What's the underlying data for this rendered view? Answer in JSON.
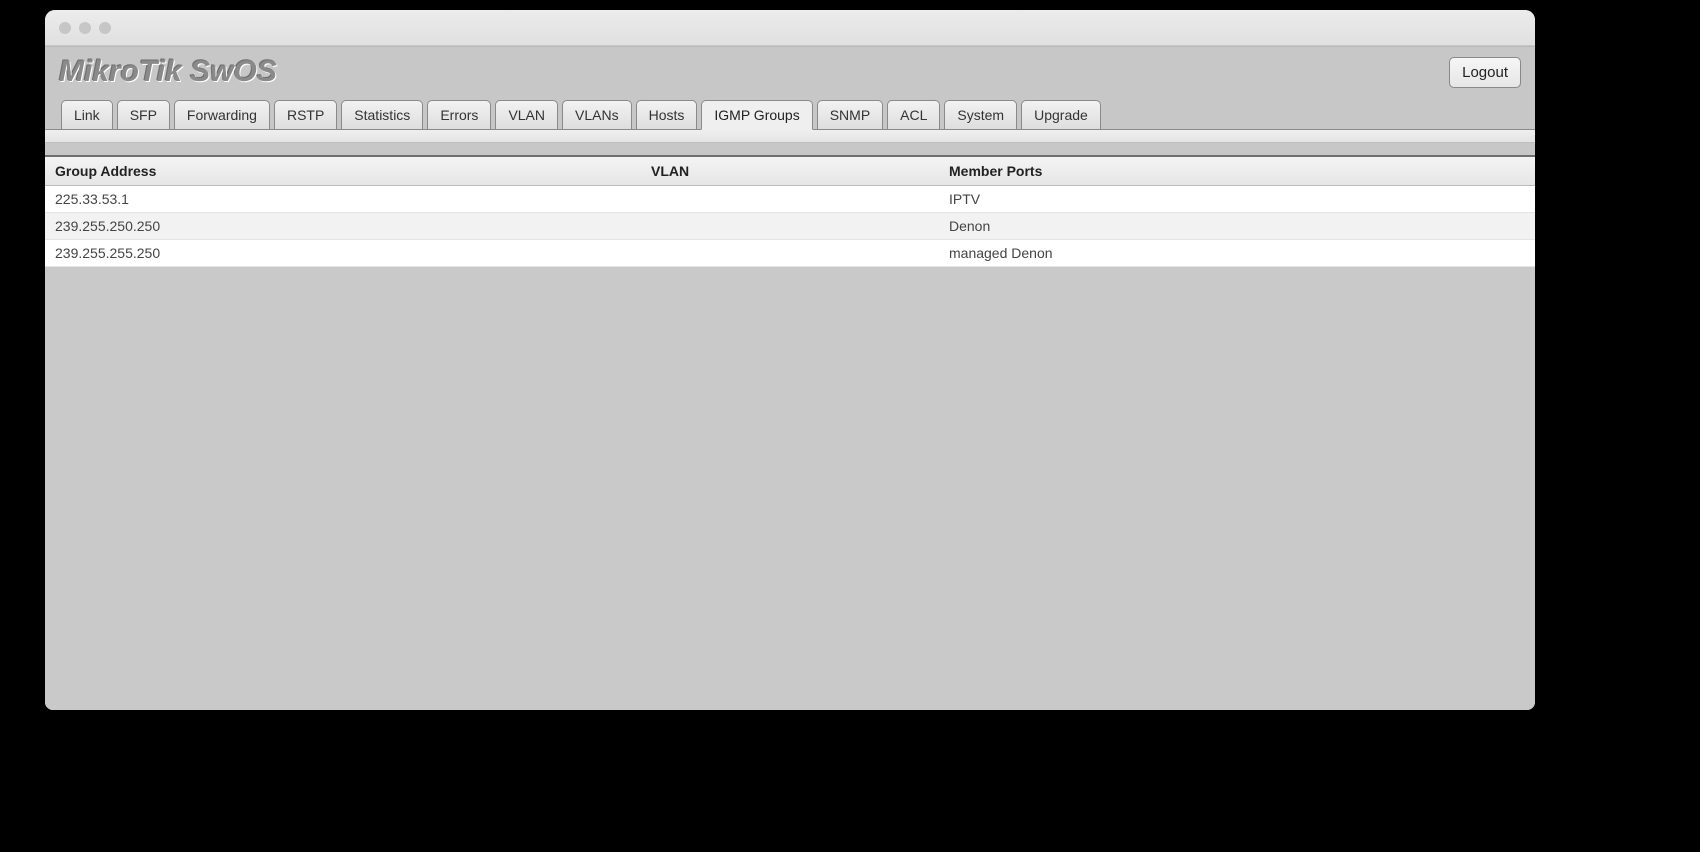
{
  "header": {
    "title": "MikroTik SwOS",
    "logout_label": "Logout"
  },
  "tabs": [
    {
      "id": "link",
      "label": "Link",
      "active": false
    },
    {
      "id": "sfp",
      "label": "SFP",
      "active": false
    },
    {
      "id": "forwarding",
      "label": "Forwarding",
      "active": false
    },
    {
      "id": "rstp",
      "label": "RSTP",
      "active": false
    },
    {
      "id": "statistics",
      "label": "Statistics",
      "active": false
    },
    {
      "id": "errors",
      "label": "Errors",
      "active": false
    },
    {
      "id": "vlan",
      "label": "VLAN",
      "active": false
    },
    {
      "id": "vlans",
      "label": "VLANs",
      "active": false
    },
    {
      "id": "hosts",
      "label": "Hosts",
      "active": false
    },
    {
      "id": "igmp-groups",
      "label": "IGMP Groups",
      "active": true
    },
    {
      "id": "snmp",
      "label": "SNMP",
      "active": false
    },
    {
      "id": "acl",
      "label": "ACL",
      "active": false
    },
    {
      "id": "system",
      "label": "System",
      "active": false
    },
    {
      "id": "upgrade",
      "label": "Upgrade",
      "active": false
    }
  ],
  "table": {
    "columns": {
      "group_address": "Group Address",
      "vlan": "VLAN",
      "member_ports": "Member Ports"
    },
    "rows": [
      {
        "group_address": "225.33.53.1",
        "vlan": "",
        "member_ports": "IPTV"
      },
      {
        "group_address": "239.255.250.250",
        "vlan": "",
        "member_ports": "Denon"
      },
      {
        "group_address": "239.255.255.250",
        "vlan": "",
        "member_ports": "managed Denon"
      }
    ]
  }
}
